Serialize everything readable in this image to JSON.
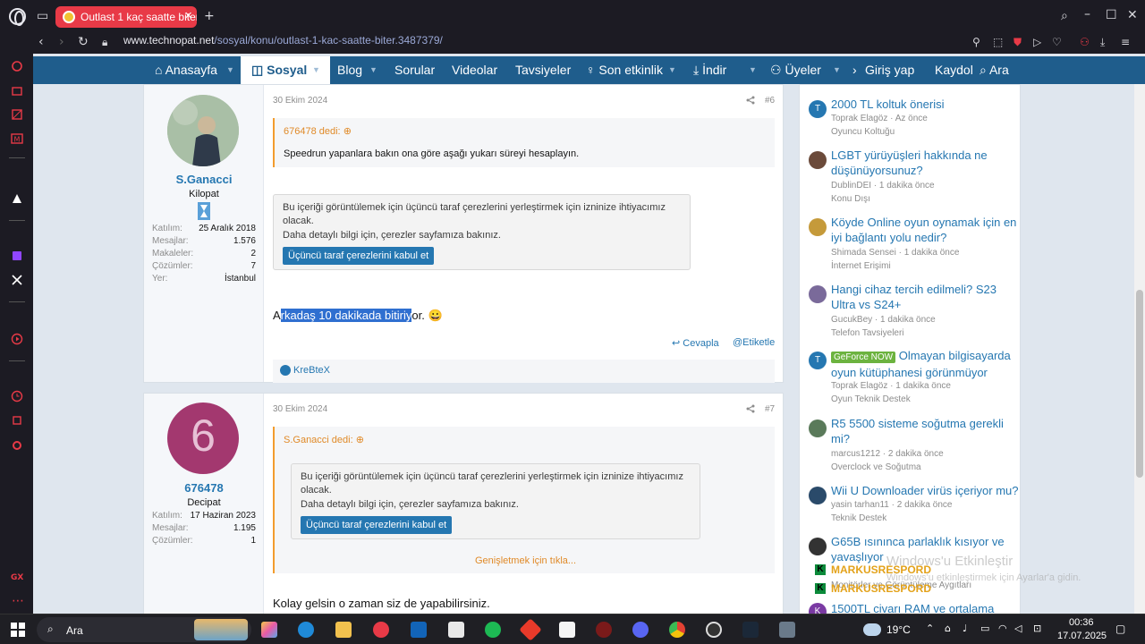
{
  "browser": {
    "tab_title": "Outlast 1 kaç saatte biter?",
    "url_host": "www.technopat.net",
    "url_path": "/sosyal/konu/outlast-1-kac-saatte-biter.3487379/",
    "accent": "#e83a47"
  },
  "nav": {
    "items": [
      {
        "label": "Anasayfa",
        "icon": "home-icon"
      },
      {
        "label": "Sosyal",
        "icon": "chat-icon"
      },
      {
        "label": "Blog"
      },
      {
        "label": "Sorular"
      },
      {
        "label": "Videolar"
      },
      {
        "label": "Tavsiyeler"
      },
      {
        "label": "Son etkinlik",
        "icon": "lightbulb-icon"
      },
      {
        "label": "İndir",
        "icon": "download-icon"
      },
      {
        "label": "Üyeler",
        "icon": "users-icon"
      }
    ],
    "login": "Giriş yap",
    "register": "Kaydol",
    "search": "Ara",
    "color": "#1f5d8c"
  },
  "posts": [
    {
      "date": "30 Ekim 2024",
      "number": "#6",
      "user": {
        "name": "S.Ganacci",
        "title": "Kilopat",
        "stats": [
          {
            "k": "Katılım:",
            "v": "25 Aralık 2018"
          },
          {
            "k": "Mesajlar:",
            "v": "1.576"
          },
          {
            "k": "Makaleler:",
            "v": "2"
          },
          {
            "k": "Çözümler:",
            "v": "7"
          },
          {
            "k": "Yer:",
            "v": "İstanbul"
          }
        ]
      },
      "quote_author": "676478 dedi:",
      "quote_text": "Speedrun yapanlara bakın ona göre aşağı yukarı süreyi hesaplayın.",
      "cookie_line1": "Bu içeriği görüntülemek için üçüncü taraf çerezlerini yerleştirmek için izninize ihtiyacımız olacak.",
      "cookie_line2": "Daha detaylı bilgi için, çerezler sayfamıza bakınız.",
      "cookie_button": "Üçüncü taraf çerezlerini kabul et",
      "message_before": "A",
      "message_selected": "rkadaş 10 dakikada bitiriy",
      "message_after": "or. 😀",
      "reply": "Cevapla",
      "tag": "Etiketle",
      "reaction_user": "KreBteX"
    },
    {
      "date": "30 Ekim 2024",
      "number": "#7",
      "user": {
        "name": "676478",
        "avatar_letter": "6",
        "avatar_color": "#a3386f",
        "title": "Decipat",
        "stats": [
          {
            "k": "Katılım:",
            "v": "17 Haziran 2023"
          },
          {
            "k": "Mesajlar:",
            "v": "1.195"
          },
          {
            "k": "Çözümler:",
            "v": "1"
          }
        ]
      },
      "quote_author": "S.Ganacci dedi:",
      "cookie_line1": "Bu içeriği görüntülemek için üçüncü taraf çerezlerini yerleştirmek için izninize ihtiyacımız olacak.",
      "cookie_line2": "Daha detaylı bilgi için, çerezler sayfamıza bakınız.",
      "cookie_button": "Üçüncü taraf çerezlerini kabul et",
      "expand": "Genişletmek için tıkla...",
      "message": "Kolay gelsin o zaman siz de yapabilirsiniz."
    }
  ],
  "sidebar": {
    "threads": [
      {
        "title": "2000 TL koltuk önerisi",
        "meta": "Toprak Elagöz · Az önce",
        "forum": "Oyuncu Koltuğu",
        "avatar_letter": "T",
        "avatar_color": "#2577b1"
      },
      {
        "title": "LGBT yürüyüşleri hakkında ne düşünüyorsunuz?",
        "meta": "DublinDEI · 1 dakika önce",
        "forum": "Konu Dışı",
        "avatar_letter": "",
        "avatar_color": "#6b4a3a"
      },
      {
        "title": "Köyde Online oyun oynamak için en iyi bağlantı yolu nedir?",
        "meta": "Shimada Sensei · 1 dakika önce",
        "forum": "İnternet Erişimi",
        "avatar_letter": "",
        "avatar_color": "#c59a3a"
      },
      {
        "title": "Hangi cihaz tercih edilmeli? S23 Ultra vs S24+",
        "meta": "GucukBey · 1 dakika önce",
        "forum": "Telefon Tavsiyeleri",
        "avatar_letter": "",
        "avatar_color": "#7a6a9a"
      },
      {
        "label": "GeForce NOW",
        "title": "Olmayan bilgisayarda oyun kütüphanesi görünmüyor",
        "meta": "Toprak Elagöz · 1 dakika önce",
        "forum": "Oyun Teknik Destek",
        "avatar_letter": "T",
        "avatar_color": "#2577b1"
      },
      {
        "title": "R5 5500 sisteme soğutma gerekli mi?",
        "meta": "marcus1212 · 2 dakika önce",
        "forum": "Overclock ve Soğutma",
        "avatar_letter": "",
        "avatar_color": "#5a7a5a"
      },
      {
        "title": "Wii U Downloader virüs içeriyor mu?",
        "meta": "yasin tarhan11 · 2 dakika önce",
        "forum": "Teknik Destek",
        "avatar_letter": "",
        "avatar_color": "#2a4a6a"
      },
      {
        "title": "G65B ısınınca parlaklık kısıyor ve yavaşlıyor",
        "meta": "",
        "forum": "Monitörler ve Görüntüleme Aygıtları",
        "avatar_letter": "",
        "avatar_color": "#333333"
      },
      {
        "title": "1500TL civarı RAM ve ortalama",
        "meta": "",
        "forum": "",
        "avatar_letter": "K",
        "avatar_color": "#7a3aa3"
      }
    ]
  },
  "watermark": {
    "title": "Windows'u Etkinleştir",
    "subtitle": "Windows'u etkinleştirmek için Ayarlar'a gidin.",
    "overlay1": "MARKUSRESPORD",
    "overlay2": "MARKUSRESPORD"
  },
  "taskbar": {
    "search": "Ara",
    "weather": "19°C",
    "time": "00:36",
    "date": "17.07.2025"
  }
}
